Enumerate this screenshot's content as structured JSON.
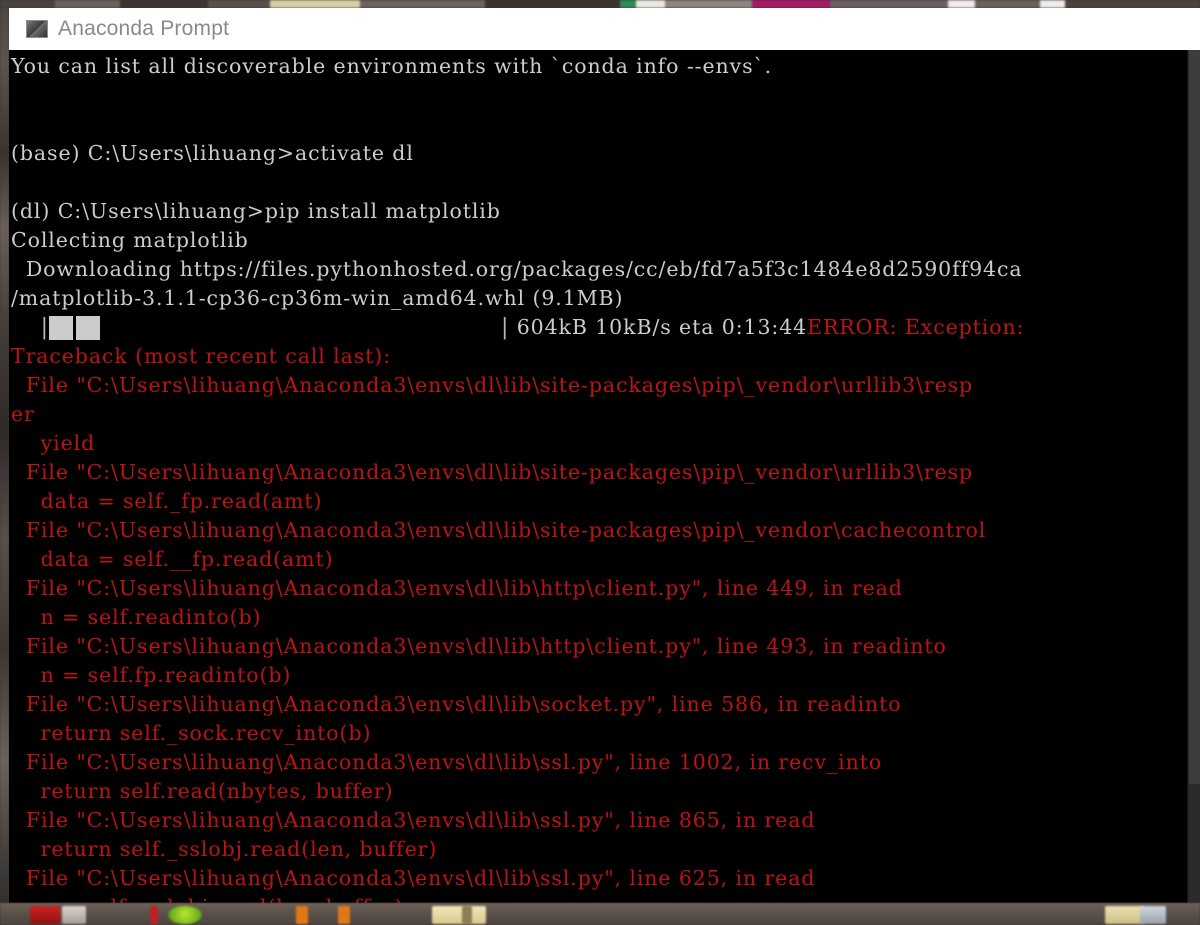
{
  "window": {
    "title": "Anaconda Prompt",
    "icon": "console-window-icon",
    "colors": {
      "titlebar_bg": "#ffffff",
      "titlebar_text": "#8a8a8a",
      "terminal_bg": "#000000",
      "terminal_text": "#cccccc",
      "error_text": "#bb1414",
      "progress_block": "#cccccc"
    }
  },
  "terminal": {
    "lines": [
      {
        "id": "l01",
        "color": "white",
        "text": "You can list all discoverable environments with `conda info --envs`."
      },
      {
        "id": "l02",
        "color": "white",
        "text": ""
      },
      {
        "id": "l03",
        "color": "white",
        "text": ""
      },
      {
        "id": "l04",
        "color": "white",
        "text": "(base) C:\\Users\\lihuang>activate dl"
      },
      {
        "id": "l05",
        "color": "white",
        "text": ""
      },
      {
        "id": "l06",
        "color": "white",
        "text": "(dl) C:\\Users\\lihuang>pip install matplotlib"
      },
      {
        "id": "l07",
        "color": "white",
        "text": "Collecting matplotlib"
      },
      {
        "id": "l08",
        "color": "white",
        "text": "  Downloading https://files.pythonhosted.org/packages/cc/eb/fd7a5f3c1484e8d2590ff94ca"
      },
      {
        "id": "l09",
        "color": "white",
        "text": "/matplotlib-3.1.1-cp36-cp36m-win_amd64.whl (9.1MB)"
      },
      {
        "id": "l11",
        "color": "red",
        "text": "Traceback (most recent call last):"
      },
      {
        "id": "l12",
        "color": "red",
        "text": "  File \"C:\\Users\\lihuang\\Anaconda3\\envs\\dl\\lib\\site-packages\\pip\\_vendor\\urllib3\\resp"
      },
      {
        "id": "l13",
        "color": "red",
        "text": "er"
      },
      {
        "id": "l14",
        "color": "red",
        "text": "    yield"
      },
      {
        "id": "l15",
        "color": "red",
        "text": "  File \"C:\\Users\\lihuang\\Anaconda3\\envs\\dl\\lib\\site-packages\\pip\\_vendor\\urllib3\\resp"
      },
      {
        "id": "l16",
        "color": "red",
        "text": "    data = self._fp.read(amt)"
      },
      {
        "id": "l17",
        "color": "red",
        "text": "  File \"C:\\Users\\lihuang\\Anaconda3\\envs\\dl\\lib\\site-packages\\pip\\_vendor\\cachecontrol"
      },
      {
        "id": "l18",
        "color": "red",
        "text": "    data = self.__fp.read(amt)"
      },
      {
        "id": "l19",
        "color": "red",
        "text": "  File \"C:\\Users\\lihuang\\Anaconda3\\envs\\dl\\lib\\http\\client.py\", line 449, in read"
      },
      {
        "id": "l20",
        "color": "red",
        "text": "    n = self.readinto(b)"
      },
      {
        "id": "l21",
        "color": "red",
        "text": "  File \"C:\\Users\\lihuang\\Anaconda3\\envs\\dl\\lib\\http\\client.py\", line 493, in readinto"
      },
      {
        "id": "l22",
        "color": "red",
        "text": "    n = self.fp.readinto(b)"
      },
      {
        "id": "l23",
        "color": "red",
        "text": "  File \"C:\\Users\\lihuang\\Anaconda3\\envs\\dl\\lib\\socket.py\", line 586, in readinto"
      },
      {
        "id": "l24",
        "color": "red",
        "text": "    return self._sock.recv_into(b)"
      },
      {
        "id": "l25",
        "color": "red",
        "text": "  File \"C:\\Users\\lihuang\\Anaconda3\\envs\\dl\\lib\\ssl.py\", line 1002, in recv_into"
      },
      {
        "id": "l26",
        "color": "red",
        "text": "    return self.read(nbytes, buffer)"
      },
      {
        "id": "l27",
        "color": "red",
        "text": "  File \"C:\\Users\\lihuang\\Anaconda3\\envs\\dl\\lib\\ssl.py\", line 865, in read"
      },
      {
        "id": "l28",
        "color": "red",
        "text": "    return self._sslobj.read(len, buffer)"
      },
      {
        "id": "l29",
        "color": "red",
        "text": "  File \"C:\\Users\\lihuang\\Anaconda3\\envs\\dl\\lib\\ssl.py\", line 625, in read"
      },
      {
        "id": "l30",
        "color": "red",
        "text": "    v = self._sslobj.read(len, buffer)"
      }
    ],
    "progress": {
      "lead_spaces": "    ",
      "left_pipe": "|",
      "blocks": 2,
      "right_pipe": "|",
      "stats": " 604kB 10kB/s eta 0:13:44",
      "error_suffix": "ERROR: Exception:"
    }
  },
  "taskbar": {
    "label": "desktop-taskbar"
  }
}
